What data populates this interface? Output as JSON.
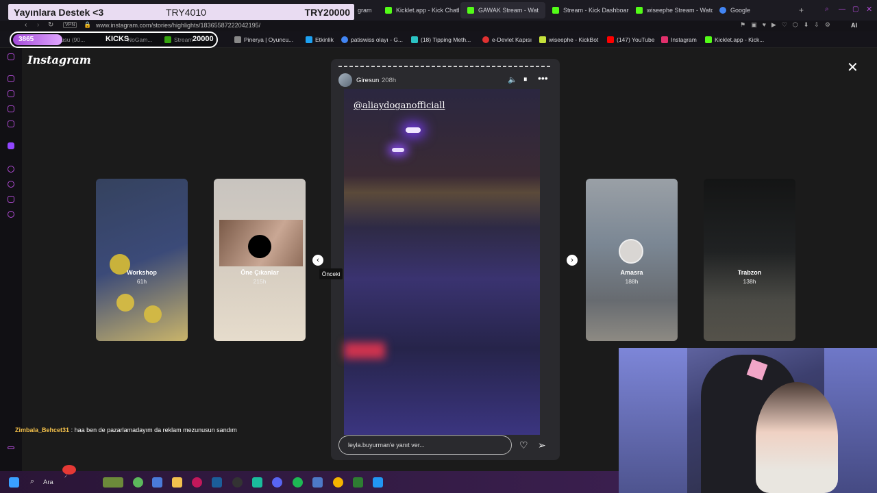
{
  "tabs": [
    {
      "label": "gram",
      "color": "#e1306c"
    },
    {
      "label": "Kicklet.app - Kick Chatbo",
      "color": "#53fc18"
    },
    {
      "label": "GAWAK Stream - Wat",
      "color": "#53fc18"
    },
    {
      "label": "Stream - Kick Dashboard",
      "color": "#53fc18"
    },
    {
      "label": "wiseephe Stream - Watc",
      "color": "#53fc18"
    },
    {
      "label": "Google",
      "color": "#4285f4"
    }
  ],
  "url": "www.instagram.com/stories/highlights/18365587222042195/",
  "vpn_label": "VPN",
  "bookmarks": [
    {
      "label": "Kutusu (90...",
      "color": "#cc3333"
    },
    {
      "label": "NoGam...",
      "color": "#d88a2b"
    },
    {
      "label": "Stream",
      "color": "#53fc18"
    },
    {
      "label": "Pinerya | Oyuncu...",
      "color": "#888"
    },
    {
      "label": "Etkinlik",
      "color": "#1da1f2"
    },
    {
      "label": "patiswiss olayı - G...",
      "color": "#4285f4"
    },
    {
      "label": "(18) Tipping Meth...",
      "color": "#2bc3c3"
    },
    {
      "label": "e-Devlet Kapısı",
      "color": "#e03131"
    },
    {
      "label": "wiseephe - KickBot",
      "color": "#c4e03b"
    },
    {
      "label": "(147) YouTube",
      "color": "#ff0000"
    },
    {
      "label": "Instagram",
      "color": "#e1306c"
    },
    {
      "label": "Kicklet.app - Kick...",
      "color": "#53fc18"
    }
  ],
  "overlay": {
    "donate_title": "Yayınlara Destek <3",
    "donate_current": "TRY4010",
    "donate_goal": "TRY20000",
    "followers": "3865",
    "kicks_label": "KICKS",
    "kicks_goal": "20000"
  },
  "instagram": {
    "logo": "Instagram",
    "story": {
      "username": "Giresun",
      "age": "208h",
      "mention": "@aliaydoganofficiall",
      "reply_placeholder": "leyla.buyurman'e yanıt ver...",
      "tooltip": "Önceki"
    },
    "highlights": [
      {
        "title": "Workshop",
        "age": "61h"
      },
      {
        "title": "Öne Çıkanlar",
        "age": "215h"
      },
      {
        "title": "Amasra",
        "age": "188h"
      },
      {
        "title": "Trabzon",
        "age": "138h"
      }
    ]
  },
  "chat": {
    "user": "Zimbala_Behcet31",
    "message": ": haa ben de pazarlamadayım da reklam mezunusun sandım"
  },
  "taskbar": {
    "search_label": "Ara"
  }
}
